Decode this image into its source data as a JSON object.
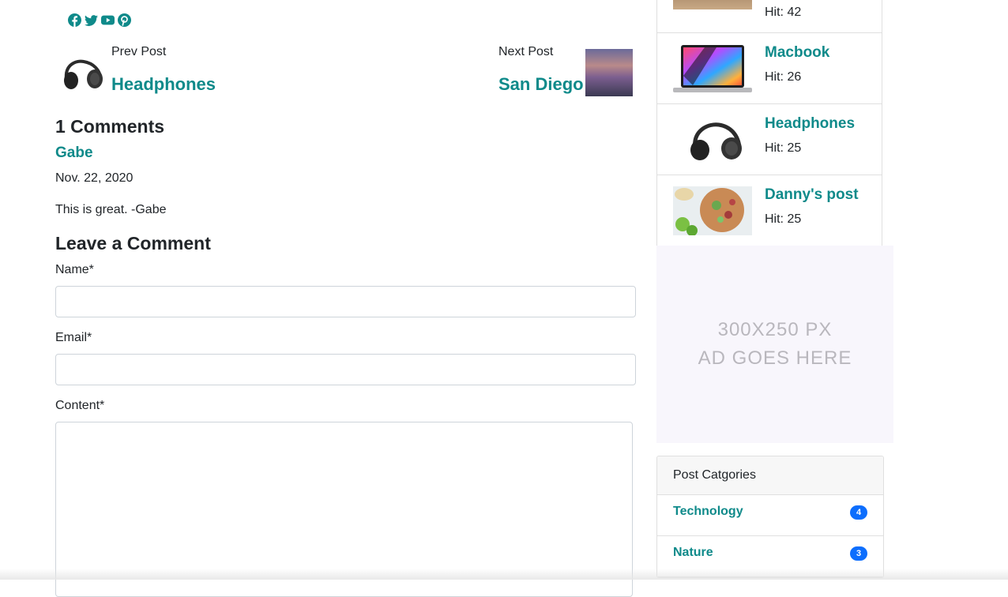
{
  "social": {
    "icons": [
      "facebook-icon",
      "twitter-icon",
      "youtube-icon",
      "pinterest-icon"
    ],
    "color": "#0f8a8a"
  },
  "navigation": {
    "prev": {
      "label": "Prev Post",
      "title": "Headphones"
    },
    "next": {
      "label": "Next Post",
      "title": "San Diego"
    }
  },
  "comments": {
    "heading": "1 Comments",
    "items": [
      {
        "author": "Gabe",
        "date": "Nov. 22, 2020",
        "body": "This is great. -Gabe"
      }
    ]
  },
  "comment_form": {
    "heading": "Leave a Comment",
    "name_label": "Name*",
    "name_value": "",
    "email_label": "Email*",
    "email_value": "",
    "content_label": "Content*",
    "content_value": ""
  },
  "popular_posts": [
    {
      "title": "",
      "hits": "Hit: 42"
    },
    {
      "title": "Macbook",
      "hits": "Hit: 26"
    },
    {
      "title": "Headphones",
      "hits": "Hit: 25"
    },
    {
      "title": "Danny's post",
      "hits": "Hit: 25"
    }
  ],
  "ad": {
    "line1": "300X250 PX",
    "line2": "AD GOES HERE"
  },
  "categories": {
    "header": "Post Catgories",
    "items": [
      {
        "name": "Technology",
        "count": "4"
      },
      {
        "name": "Nature",
        "count": "3"
      }
    ]
  },
  "colors": {
    "accent": "#0f8a8a",
    "badge": "#0d6efd"
  }
}
